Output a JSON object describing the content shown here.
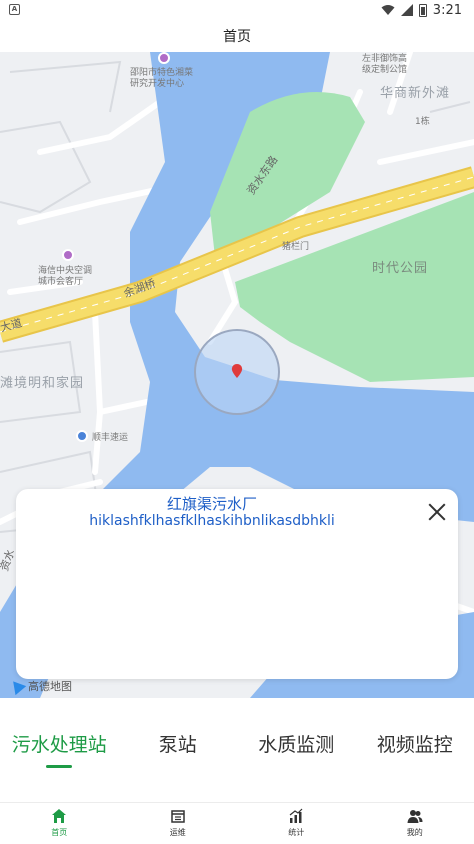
{
  "status_bar": {
    "left_icon": "A",
    "time": "3:21",
    "icons": [
      "wifi-icon",
      "signal-icon",
      "battery-icon"
    ]
  },
  "header": {
    "title": "首页"
  },
  "map": {
    "labels": {
      "research_center": "邵阳市特色湘菜\n研究开发中心",
      "custom_office": "左非御饰高\n级定制公馆",
      "huashang": "华商新外滩",
      "building": "1栋",
      "zishui_east_road": "资水东路",
      "zhulanmen": "猪栏门",
      "times_park": "时代公园",
      "yuhu_bridge": "余湖桥",
      "haixin": "海信中央空调\n城市会客厅",
      "avenue": "大道",
      "jingming": "滩境明和家园",
      "sf": "顺丰速运",
      "road_left": "资水"
    },
    "brand": "高德地图",
    "colors": {
      "water": "#8fbaf0",
      "park": "#a6e3b4",
      "road": "#f2d55a",
      "land": "#eef0f3"
    }
  },
  "popup": {
    "title": "红旗渠污水厂",
    "subtitle": "hiklashfklhasfklhaskihbnlikasdbhkli",
    "close_icon": "close-icon"
  },
  "tabs": [
    {
      "label": "污水处理站",
      "active": true
    },
    {
      "label": "泵站",
      "active": false
    },
    {
      "label": "水质监测",
      "active": false
    },
    {
      "label": "视频监控",
      "active": false
    }
  ],
  "bottom_nav": [
    {
      "label": "首页",
      "icon": "home-icon",
      "active": true
    },
    {
      "label": "运维",
      "icon": "maintenance-icon",
      "active": false
    },
    {
      "label": "统计",
      "icon": "statistics-icon",
      "active": false
    },
    {
      "label": "我的",
      "icon": "profile-icon",
      "active": false
    }
  ]
}
